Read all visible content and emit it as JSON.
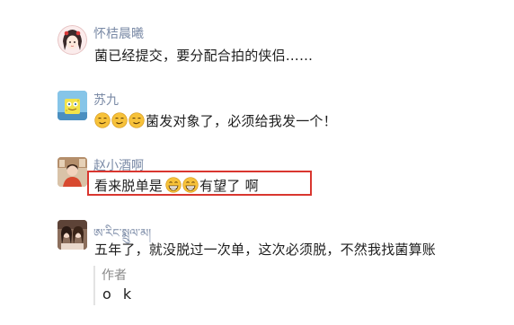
{
  "comments": [
    {
      "name": "怀桔晨曦",
      "text": "菌已经提交，要分配合拍的侠侣……",
      "avatar": "anime-girl-avatar"
    },
    {
      "name": "苏九",
      "text": "菌发对象了，必须给我发一个！",
      "emojis": [
        "smirk-face-emoji",
        "smirk-face-emoji",
        "smirk-face-emoji"
      ],
      "avatar": "sponge-character-avatar"
    },
    {
      "name": "赵小酒啊",
      "text_before": "看来脱单是",
      "text_after": "有望了 啊",
      "emojis": [
        "grin-face-emoji",
        "grin-face-emoji"
      ],
      "avatar": "photo-avatar",
      "highlight_color": "#d9362f"
    },
    {
      "name": "ཨ་རིང་སྨྲུལ་མ།",
      "text": "五年了，就没脱过一次单，这次必须脱，不然我找菌算账",
      "avatar": "two-girls-photo-avatar",
      "reply": {
        "author": "作者",
        "text": "o k"
      }
    }
  ],
  "colors": {
    "name": "#7a8aa6",
    "highlight": "#d9362f"
  }
}
